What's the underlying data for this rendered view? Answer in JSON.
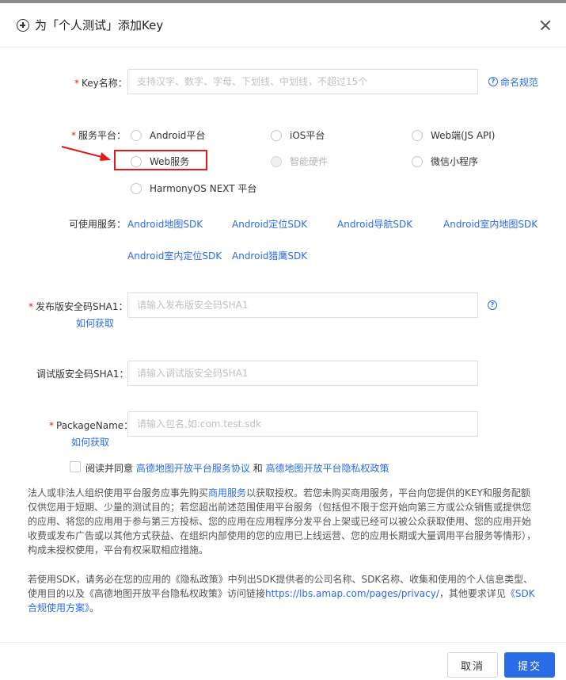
{
  "dialog": {
    "title": "为「个人测试」添加Key"
  },
  "form": {
    "key_name": {
      "label": "Key名称：",
      "placeholder": "支持汉字、数字、字母、下划线、中划线，不超过15个",
      "help_link": "命名规范"
    },
    "platform": {
      "label": "服务平台：",
      "options": [
        {
          "label": "Android平台",
          "disabled": false
        },
        {
          "label": "iOS平台",
          "disabled": false
        },
        {
          "label": "Web端(JS API)",
          "disabled": false
        },
        {
          "label": "Web服务",
          "disabled": false
        },
        {
          "label": "智能硬件",
          "disabled": true
        },
        {
          "label": "微信小程序",
          "disabled": false
        },
        {
          "label": "HarmonyOS NEXT 平台",
          "disabled": false
        }
      ]
    },
    "services": {
      "label": "可使用服务：",
      "items": [
        "Android地图SDK",
        "Android定位SDK",
        "Android导航SDK",
        "Android室内地图SDK",
        "Android室内定位SDK",
        "Android猎鹰SDK"
      ]
    },
    "release_sha1": {
      "label": "发布版安全码SHA1：",
      "placeholder": "请输入发布版安全码SHA1",
      "how_link": "如何获取"
    },
    "debug_sha1": {
      "label": "调试版安全码SHA1：",
      "placeholder": "请输入调试版安全码SHA1"
    },
    "package_name": {
      "label": "PackageName：",
      "placeholder": "请输入包名,如:com.test.sdk",
      "how_link": "如何获取"
    },
    "agreement": {
      "prefix": "阅读并同意",
      "link1": "高德地图开放平台服务协议",
      "and": "和",
      "link2": "高德地图开放平台隐私权政策"
    }
  },
  "notice": {
    "p1_a": "法人或非法人组织使用平台服务应事先购买",
    "p1_link": "商用服务",
    "p1_b": "以获取授权。若您未购买商用服务，平台向您提供的KEY和服务配额仅供您用于短期、少量的测试目的；若您超出前述范围使用平台服务（包括但不限于您开始向第三方或公众销售或提供您的应用、将您的应用用于参与第三方投标、您的应用在应用程序分发平台上架或已经可以被公众获取使用、您的应用开始收费或发布广告或以其他方式获益、在组织内部使用的您的应用已上线运营、您的应用长期或大量调用平台服务等情形），构成未授权使用，平台有权采取相应措施。",
    "p2_a": "若使用SDK，请务必在您的应用的《隐私政策》中列出SDK提供者的公司名称、SDK名称、收集和使用的个人信息类型、使用目的以及《高德地图开放平台隐私权政策》访问链接",
    "p2_link": "https://lbs.amap.com/pages/privacy/",
    "p2_b": "，其他要求详见",
    "p2_link2": "《SDK合规使用方案》",
    "p2_c": "。"
  },
  "footer": {
    "cancel": "取消",
    "submit": "提交"
  },
  "colors": {
    "link": "#2b6be6",
    "required": "#e02020",
    "annotation": "#e11b1b"
  }
}
